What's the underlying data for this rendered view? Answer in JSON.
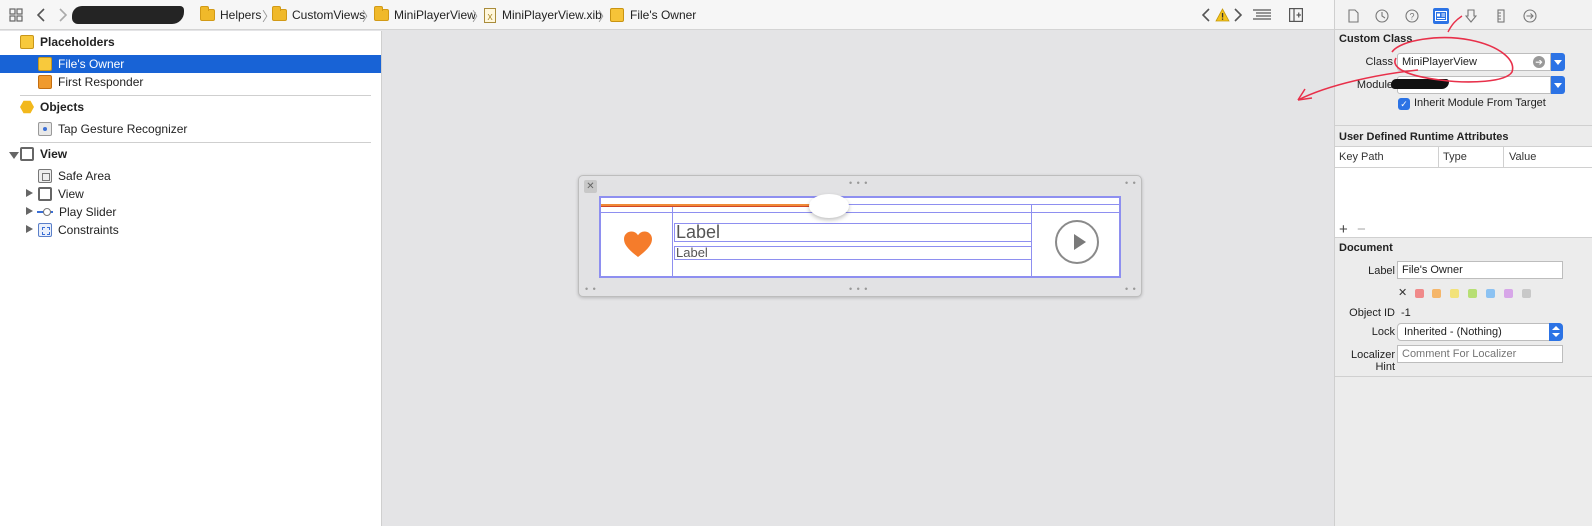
{
  "jumpbar": {
    "breadcrumbs": [
      {
        "label": "Helpers",
        "kind": "folder"
      },
      {
        "label": "CustomViews",
        "kind": "folder"
      },
      {
        "label": "MiniPlayerView",
        "kind": "folder"
      },
      {
        "label": "MiniPlayerView.xib",
        "kind": "xib"
      },
      {
        "label": "File's Owner",
        "kind": "cube"
      }
    ]
  },
  "outline": {
    "placeholders": {
      "title": "Placeholders",
      "items": [
        "File's Owner",
        "First Responder"
      ]
    },
    "objects": {
      "title": "Objects",
      "items": [
        "Tap Gesture Recognizer"
      ]
    },
    "view": {
      "title": "View",
      "items": [
        "Safe Area",
        "View",
        "Play Slider",
        "Constraints"
      ]
    }
  },
  "canvas": {
    "title_label": "Label",
    "subtitle_label": "Label",
    "progress": 0.41
  },
  "inspector": {
    "custom_class": {
      "title": "Custom Class",
      "class_label": "Class",
      "class_value": "MiniPlayerView",
      "module_label": "Module",
      "inherit_label": "Inherit Module From Target"
    },
    "runtime_attrs": {
      "title": "User Defined Runtime Attributes",
      "columns": [
        "Key Path",
        "Type",
        "Value"
      ],
      "add_symbol": "+",
      "remove_symbol": "−"
    },
    "document": {
      "title": "Document",
      "label_label": "Label",
      "label_value": "File's Owner",
      "clear_symbol": "✕",
      "object_id_label": "Object ID",
      "object_id_value": "-1",
      "lock_label": "Lock",
      "lock_value": "Inherited - (Nothing)",
      "hint_label": "Localizer Hint",
      "hint_placeholder": "Comment For Localizer"
    }
  },
  "colors": {
    "selection": "#1863d6",
    "accent": "#2c73e5",
    "guide": "#8e8ff0",
    "heart": "#f57c2b",
    "annotation": "#e8304a",
    "swatches": [
      "#f08a8a",
      "#f5b66a",
      "#f2e27a",
      "#b7df74",
      "#8cc2f2",
      "#d7a6e8",
      "#c8c8c8"
    ]
  }
}
